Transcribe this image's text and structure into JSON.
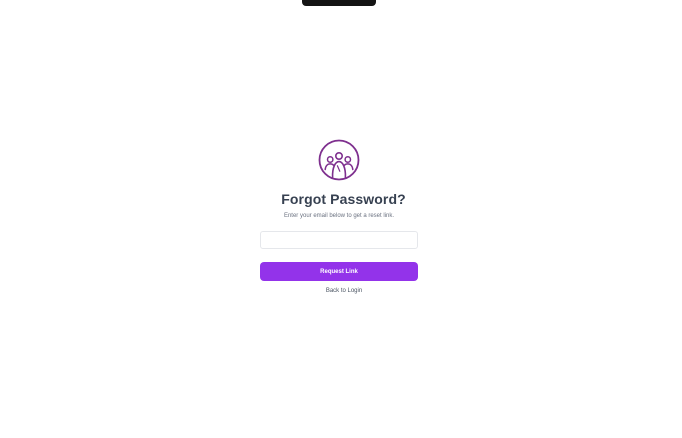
{
  "form": {
    "title": "Forgot Password?",
    "subtitle": "Enter your email below to get a reset link.",
    "email_value": "",
    "email_placeholder": "",
    "submit_label": "Request Link",
    "back_label": "Back to Login"
  },
  "colors": {
    "accent": "#9333ea",
    "logo": "#7e2f8e",
    "title_text": "#374151"
  },
  "icons": {
    "logo": "group-people-icon"
  }
}
